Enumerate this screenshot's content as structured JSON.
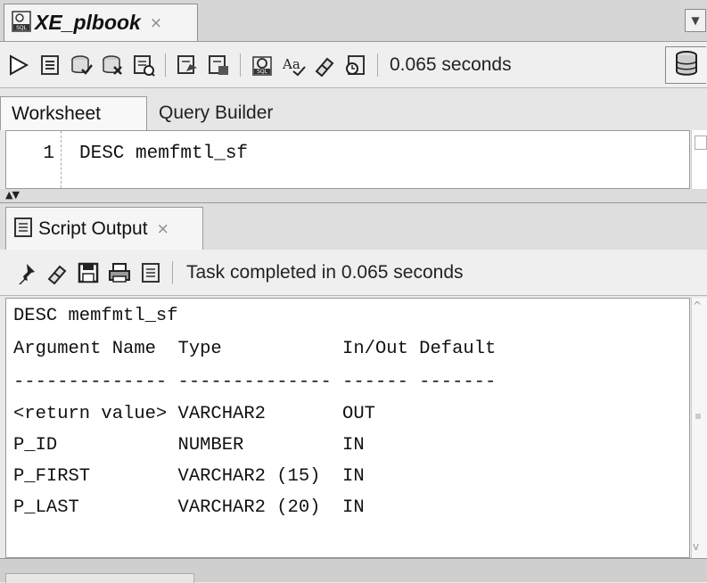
{
  "document_tab": {
    "title": "XE_plbook",
    "close": "×"
  },
  "toolbar": {
    "timing": "0.065 seconds"
  },
  "editor_tabs": [
    {
      "label": "Worksheet"
    },
    {
      "label": "Query Builder"
    }
  ],
  "editor": {
    "line_number": "1",
    "code": "DESC memfmtl_sf"
  },
  "output_tab": {
    "label": "Script Output",
    "close": "×"
  },
  "output_toolbar": {
    "status": "Task completed in 0.065 seconds"
  },
  "output_lines": [
    "DESC memfmtl_sf",
    "Argument Name  Type           In/Out Default",
    "-------------- -------------- ------ -------",
    "<return value> VARCHAR2       OUT",
    "P_ID           NUMBER         IN",
    "P_FIRST        VARCHAR2 (15)  IN",
    "P_LAST         VARCHAR2 (20)  IN"
  ]
}
